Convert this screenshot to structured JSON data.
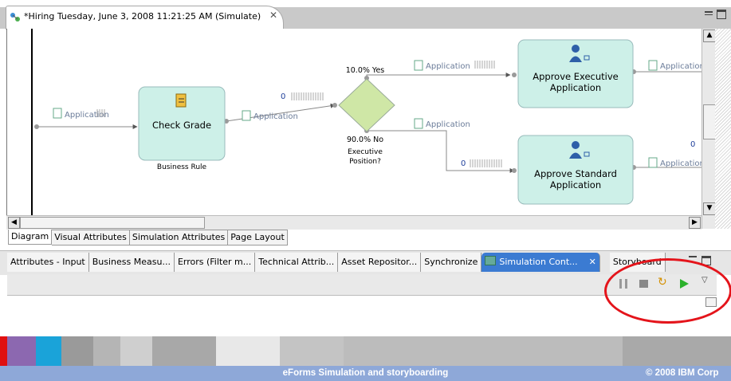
{
  "editor": {
    "tab_title": "*Hiring Tuesday, June 3, 2008 11:21:25 AM (Simulate)",
    "close_glyph": "✕"
  },
  "diagram": {
    "nodes": {
      "check_grade": {
        "label": "Check Grade",
        "caption": "Business Rule"
      },
      "approve_exec": {
        "label_line1": "Approve Executive",
        "label_line2": "Application"
      },
      "approve_std": {
        "label_line1": "Approve Standard",
        "label_line2": "Application"
      },
      "decision": {
        "yes_label": "10.0% Yes",
        "no_label": "90.0% No",
        "caption_line1": "Executive",
        "caption_line2": "Position?"
      }
    },
    "connector_label": "Application",
    "counter_zero": "0"
  },
  "diagram_tabs": [
    "Diagram",
    "Visual Attributes",
    "Simulation Attributes",
    "Page Layout"
  ],
  "view_tabs": [
    "Attributes - Input",
    "Business Measu...",
    "Errors (Filter m...",
    "Technical Attrib...",
    "Asset Repositor...",
    "Synchronize",
    "Simulation Cont...",
    "Storyboard"
  ],
  "active_view_close": "✕",
  "toolbar_icons": [
    "pause-icon",
    "stop-icon",
    "step-icon",
    "run-icon",
    "view-menu-icon"
  ],
  "footer": {
    "title": "eForms   Simulation and storyboarding",
    "copyright": "© 2008 IBM Corp"
  },
  "colors": {
    "task_fill": "#cdf0e8",
    "decision_fill": "#cfe7a6",
    "highlight": "#e4141b",
    "footer": "#8ea8d8"
  }
}
